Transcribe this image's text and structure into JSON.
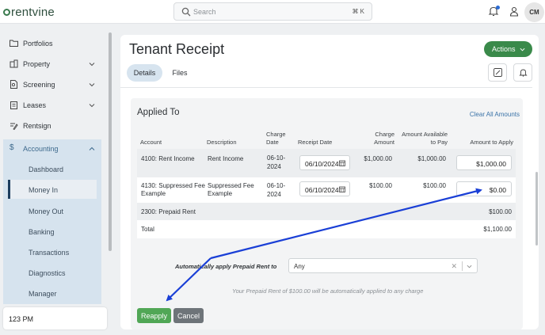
{
  "app": {
    "logo_text": "rentvine"
  },
  "search": {
    "placeholder": "Search",
    "shortcut": "⌘ K"
  },
  "user": {
    "initials": "CM"
  },
  "sidebar": {
    "items": [
      {
        "label": "Portfolios",
        "icon": "folder-icon"
      },
      {
        "label": "Property",
        "icon": "building-icon"
      },
      {
        "label": "Screening",
        "icon": "document-search-icon"
      },
      {
        "label": "Leases",
        "icon": "clipboard-icon"
      },
      {
        "label": "Rentsign",
        "icon": "signature-icon"
      },
      {
        "label": "Accounting",
        "icon": "dollar-icon"
      }
    ],
    "accounting_sub": [
      "Dashboard",
      "Money In",
      "Money Out",
      "Banking",
      "Transactions",
      "Diagnostics",
      "Manager"
    ],
    "active_sub": "Money In",
    "clock": "123 PM"
  },
  "page": {
    "title": "Tenant Receipt",
    "actions_label": "Actions",
    "tabs": [
      "Details",
      "Files"
    ],
    "active_tab": "Details"
  },
  "applied": {
    "title": "Applied To",
    "clear_all": "Clear All Amounts",
    "headers": {
      "account": "Account",
      "description": "Description",
      "charge_date_1": "Charge",
      "charge_date_2": "Date",
      "receipt_date": "Receipt Date",
      "charge_amount_1": "Charge",
      "charge_amount_2": "Amount",
      "available_1": "Amount Available",
      "available_2": "to Pay",
      "amount_to_apply": "Amount to Apply"
    },
    "rows": [
      {
        "account_1": "4100: Rent Income",
        "account_2": "",
        "description_1": "Rent Income",
        "description_2": "",
        "charge_date_1": "06-10-",
        "charge_date_2": "2024",
        "receipt_date": "06/10/2024",
        "charge_amount": "$1,000.00",
        "available": "$1,000.00",
        "amount_to_apply": "$1,000.00"
      },
      {
        "account_1": "4130: Suppressed Fee",
        "account_2": "Example",
        "description_1": "Suppressed Fee",
        "description_2": "Example",
        "charge_date_1": "06-10-",
        "charge_date_2": "2024",
        "receipt_date": "06/10/2024",
        "charge_amount": "$100.00",
        "available": "$100.00",
        "amount_to_apply": "$0.00"
      }
    ],
    "prepaid": {
      "label": "2300: Prepaid Rent",
      "amount": "$100.00"
    },
    "total": {
      "label": "Total",
      "amount": "$1,100.00"
    },
    "auto_apply_label": "Automatically apply Prepaid Rent to",
    "auto_apply_value": "Any",
    "note": "Your Prepaid Rent of $100.00 will be automatically applied to any charge",
    "reapply_label": "Reapply",
    "cancel_label": "Cancel"
  },
  "colors": {
    "primary_green": "#3a8a4a",
    "reapply_green": "#51a756",
    "arrow_blue": "#1a3fd6",
    "accounting_panel": "#d6e3ee"
  }
}
